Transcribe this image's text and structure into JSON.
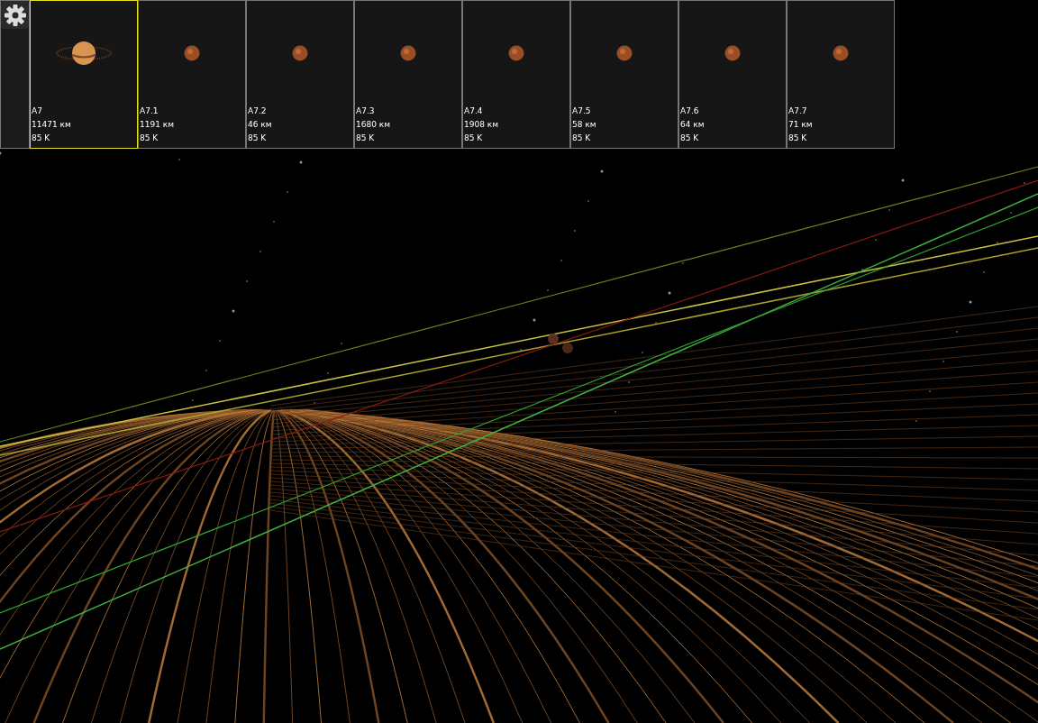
{
  "bodies": [
    {
      "name": "A7",
      "size": "11471 км",
      "temperature": "85 K",
      "kind": "ringed",
      "selected": true
    },
    {
      "name": "A7.1",
      "size": "1191 км",
      "temperature": "85 K",
      "kind": "moon",
      "selected": false
    },
    {
      "name": "A7.2",
      "size": "46 км",
      "temperature": "85 K",
      "kind": "moon",
      "selected": false
    },
    {
      "name": "A7.3",
      "size": "1680 км",
      "temperature": "85 K",
      "kind": "moon",
      "selected": false
    },
    {
      "name": "A7.4",
      "size": "1908 км",
      "temperature": "85 K",
      "kind": "moon",
      "selected": false
    },
    {
      "name": "A7.5",
      "size": "58 км",
      "temperature": "85 K",
      "kind": "moon",
      "selected": false
    },
    {
      "name": "A7.6",
      "size": "64 км",
      "temperature": "85 K",
      "kind": "moon",
      "selected": false
    },
    {
      "name": "A7.7",
      "size": "71 км",
      "temperature": "85 K",
      "kind": "moon",
      "selected": false
    }
  ]
}
